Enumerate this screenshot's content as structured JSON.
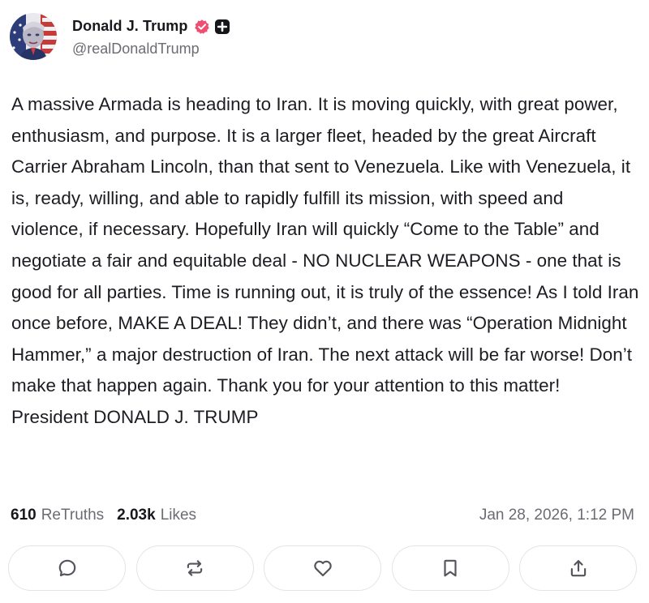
{
  "author": {
    "display_name": "Donald J. Trump",
    "handle": "@realDonaldTrump",
    "verified_icon": "verified-badge-icon",
    "badge_icon": "plus-badge-icon",
    "avatar": "flag-portrait-avatar"
  },
  "post": {
    "text": "A massive Armada is heading to Iran. It is moving quickly, with great power, enthusiasm, and purpose. It is a larger fleet, headed by the great Aircraft Carrier Abraham Lincoln, than that sent to Venezuela. Like with Venezuela, it is, ready, willing, and able to rapidly fulfill its mission, with speed and violence, if necessary. Hopefully Iran will quickly “Come to the Table” and negotiate a fair and equitable deal - NO NUCLEAR WEAPONS - one that is good for all parties. Time is running out, it is truly of the essence! As I told Iran once before, MAKE A DEAL! They didn’t, and there was “Operation Midnight Hammer,” a major destruction of Iran. The next attack will be far worse! Don’t make that happen again. Thank you for your attention to this matter!  President DONALD J. TRUMP"
  },
  "stats": {
    "retruths_count": "610",
    "retruths_label": "ReTruths",
    "likes_count": "2.03k",
    "likes_label": "Likes",
    "timestamp": "Jan 28, 2026, 1:12 PM"
  },
  "actions": [
    {
      "name": "reply",
      "icon": "comment-icon"
    },
    {
      "name": "retruth",
      "icon": "repost-icon"
    },
    {
      "name": "like",
      "icon": "heart-icon"
    },
    {
      "name": "bookmark",
      "icon": "bookmark-icon"
    },
    {
      "name": "share",
      "icon": "share-icon"
    }
  ],
  "colors": {
    "text": "#1d1c22",
    "muted": "#6c6b73",
    "verified": "#ee4e6f",
    "button_border": "#e4e3e8"
  }
}
